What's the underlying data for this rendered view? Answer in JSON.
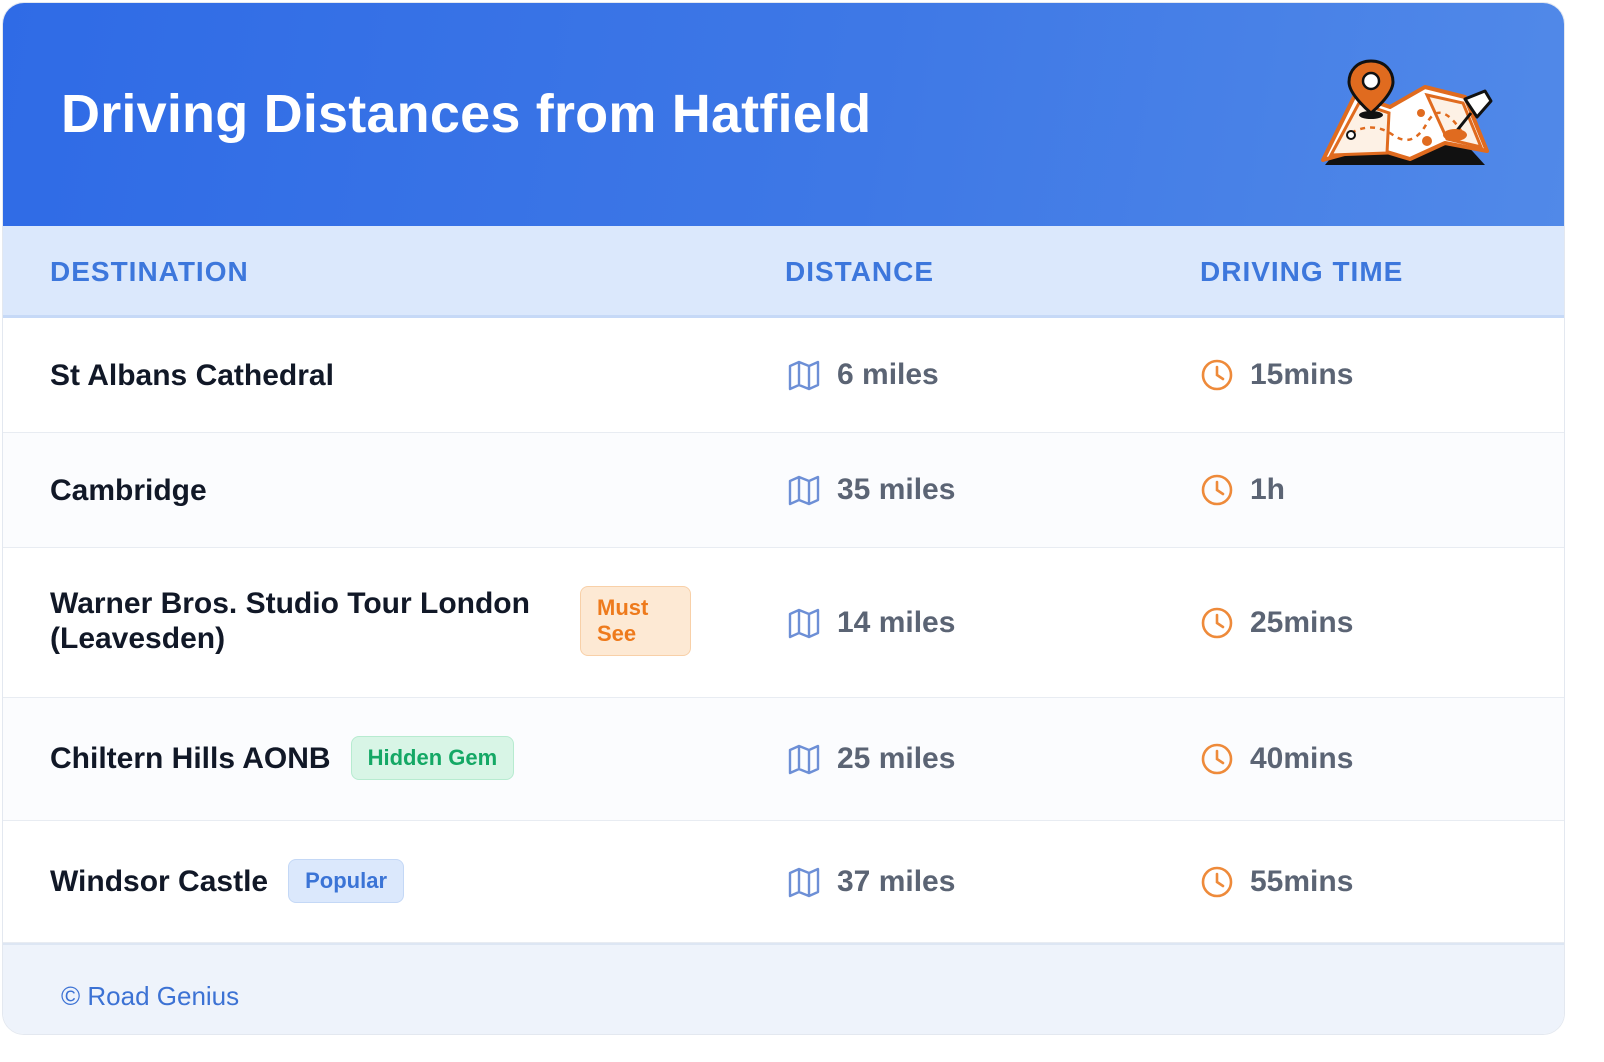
{
  "header": {
    "title": "Driving Distances from Hatfield"
  },
  "table": {
    "columns": [
      "DESTINATION",
      "DISTANCE",
      "DRIVING TIME"
    ],
    "rows": [
      {
        "destination": "St Albans Cathedral",
        "badge": "",
        "badge_color": "",
        "distance": "6 miles",
        "time": "15mins"
      },
      {
        "destination": "Cambridge",
        "badge": "",
        "badge_color": "",
        "distance": "35 miles",
        "time": "1h"
      },
      {
        "destination": "Warner Bros. Studio Tour London (Leavesden)",
        "badge": "Must See",
        "badge_color": "orange",
        "distance": "14 miles",
        "time": "25mins"
      },
      {
        "destination": "Chiltern Hills AONB",
        "badge": "Hidden Gem",
        "badge_color": "green",
        "distance": "25 miles",
        "time": "40mins"
      },
      {
        "destination": "Windsor Castle",
        "badge": "Popular",
        "badge_color": "blue",
        "distance": "37 miles",
        "time": "55mins"
      }
    ]
  },
  "icons": {
    "distance": "map-icon",
    "time": "clock-icon",
    "illustration": "folded-map-with-pins"
  },
  "colors": {
    "header": "#3a73e6",
    "accent": "#3d77dc",
    "clock": "#ee8a3a",
    "map_icon": "#6d8fd6"
  },
  "footer": {
    "credit": "© Road Genius"
  }
}
